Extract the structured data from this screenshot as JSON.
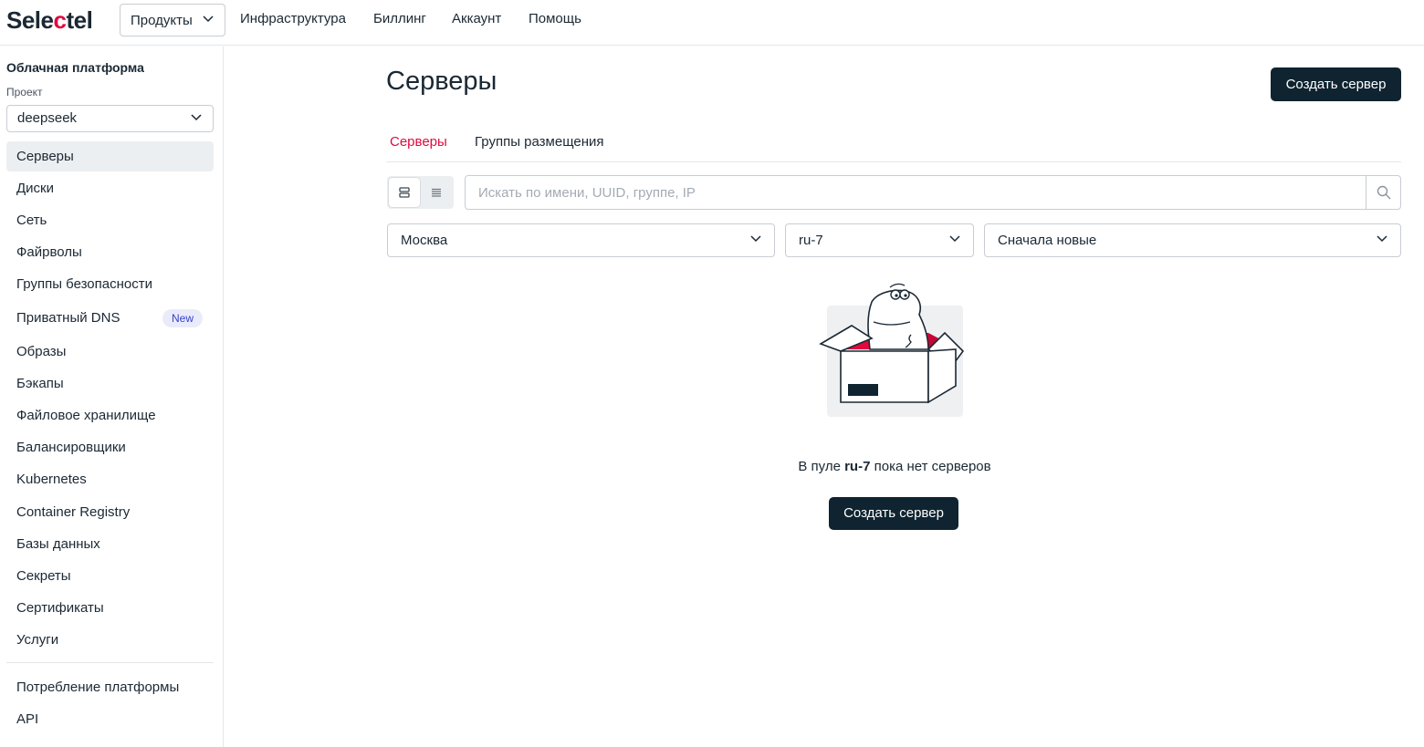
{
  "brand": {
    "logo_start": "Sele",
    "logo_accent": "c",
    "logo_end": "tel",
    "accent_color": "#e1093f"
  },
  "topnav": {
    "products": "Продукты",
    "items": [
      "Инфраструктура",
      "Биллинг",
      "Аккаунт",
      "Помощь"
    ]
  },
  "sidebar": {
    "title": "Облачная платформа",
    "project_label": "Проект",
    "project_value": "deepseek",
    "items": [
      {
        "label": "Серверы",
        "active": true
      },
      {
        "label": "Диски"
      },
      {
        "label": "Сеть"
      },
      {
        "label": "Файрволы"
      },
      {
        "label": "Группы безопасности"
      },
      {
        "label": "Приватный DNS",
        "badge": "New"
      },
      {
        "label": "Образы"
      },
      {
        "label": "Бэкапы"
      },
      {
        "label": "Файловое хранилище"
      },
      {
        "label": "Балансировщики"
      },
      {
        "label": "Kubernetes"
      },
      {
        "label": "Container Registry"
      },
      {
        "label": "Базы данных"
      },
      {
        "label": "Секреты"
      },
      {
        "label": "Сертификаты"
      },
      {
        "label": "Услуги"
      }
    ],
    "bottom_items": [
      {
        "label": "Потребление платформы"
      },
      {
        "label": "API"
      }
    ]
  },
  "main": {
    "title": "Серверы",
    "create_button": "Создать сервер",
    "tabs": [
      {
        "label": "Серверы",
        "active": true
      },
      {
        "label": "Группы размещения"
      }
    ],
    "search_placeholder": "Искать по имени, UUID, группе, IP",
    "filters": {
      "region": "Москва",
      "pool": "ru-7",
      "sort": "Сначала новые"
    },
    "empty_state": {
      "text_before": "В пуле ",
      "pool": "ru-7",
      "text_after": " пока нет серверов",
      "button": "Создать сервер"
    }
  },
  "icons": [
    "chevron-down-icon",
    "card-view-icon",
    "list-view-icon",
    "search-icon",
    "dinosaur-box-illustration"
  ]
}
